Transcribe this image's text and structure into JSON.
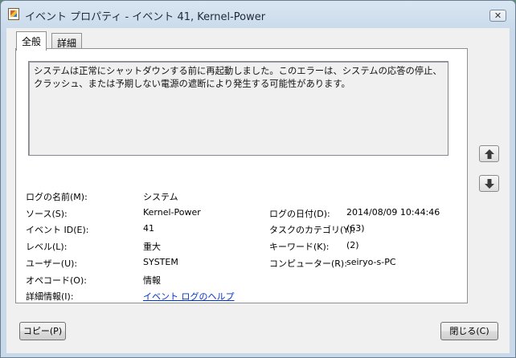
{
  "window": {
    "title": "イベント プロパティ - イベント 41, Kernel-Power",
    "close_glyph": "✕"
  },
  "tabs": [
    {
      "label": "全般"
    },
    {
      "label": "詳細"
    }
  ],
  "description": "システムは正常にシャットダウンする前に再起動しました。このエラーは、システムの応答の停止、クラッシュ、または予期しない電源の遮断により発生する可能性があります。",
  "fields": {
    "log_name": {
      "label": "ログの名前(M):",
      "value": "システム"
    },
    "source": {
      "label": "ソース(S):",
      "value": "Kernel-Power"
    },
    "logged": {
      "label": "ログの日付(D):",
      "value": "2014/08/09 10:44:46"
    },
    "event_id": {
      "label": "イベント ID(E):",
      "value": "41"
    },
    "task_category": {
      "label": "タスクのカテゴリ(Y):",
      "value": "(63)"
    },
    "level": {
      "label": "レベル(L):",
      "value": "重大"
    },
    "keywords": {
      "label": "キーワード(K):",
      "value": "(2)"
    },
    "user": {
      "label": "ユーザー(U):",
      "value": "SYSTEM"
    },
    "computer": {
      "label": "コンピューター(R):",
      "value": "seiryo-s-PC"
    },
    "opcode": {
      "label": "オペコード(O):",
      "value": "情報"
    },
    "more_info": {
      "label": "詳細情報(I):",
      "value": "イベント ログのヘルプ"
    }
  },
  "buttons": {
    "copy": "コピー(P)",
    "close": "閉じる(C)",
    "prev_icon": "up-arrow-icon",
    "next_icon": "down-arrow-icon"
  }
}
